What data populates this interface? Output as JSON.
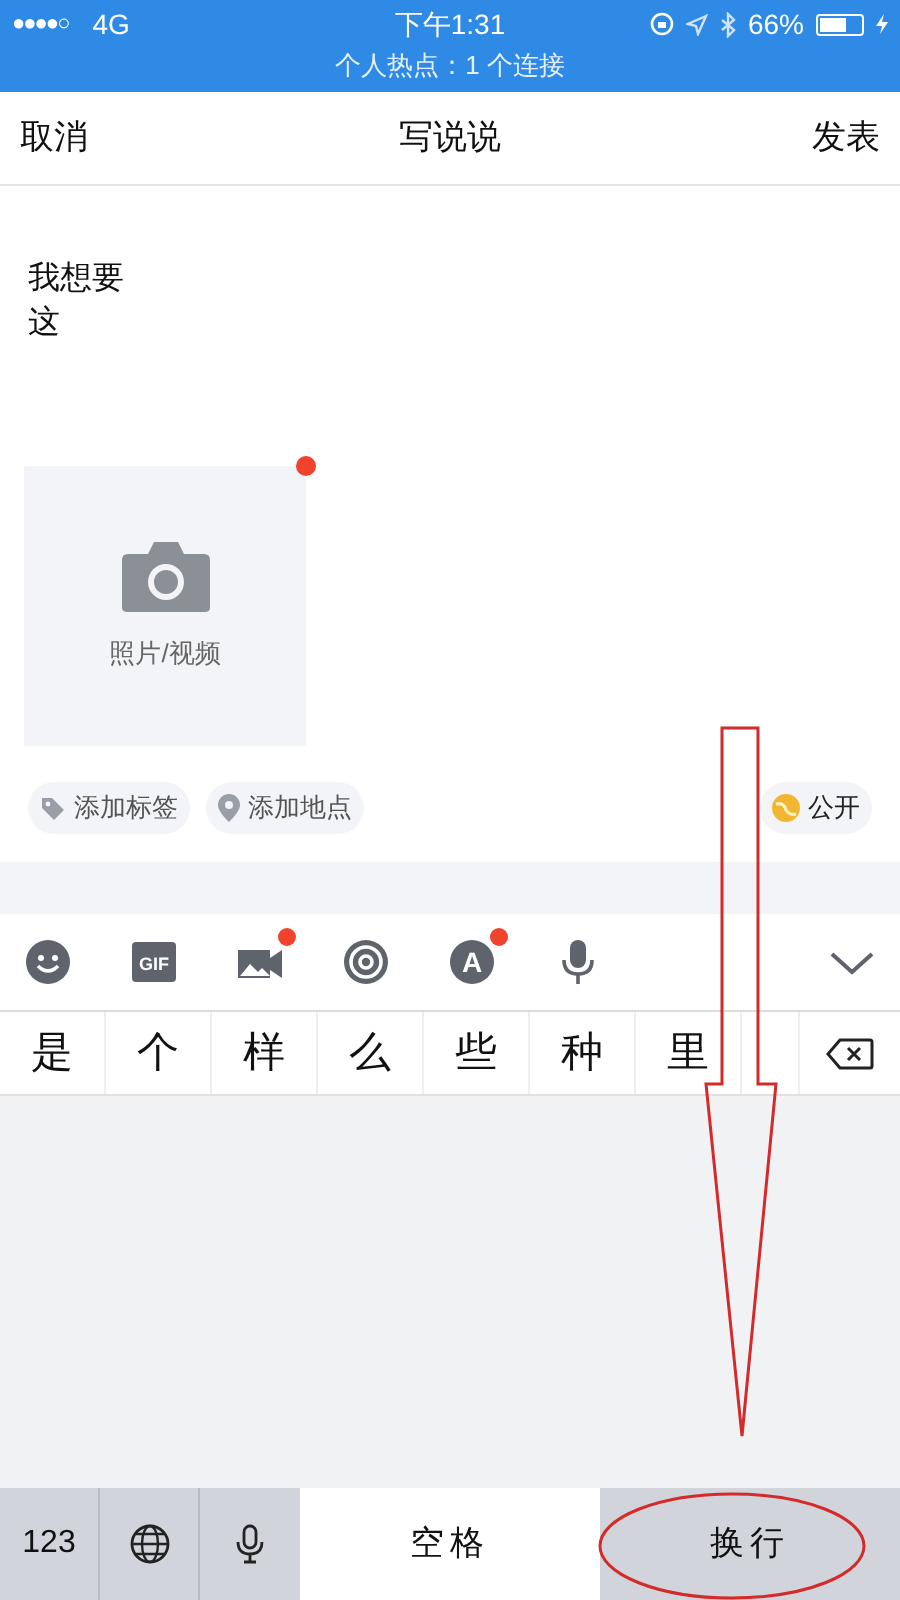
{
  "status_bar": {
    "carrier": "●●●●○",
    "network": "4G",
    "time": "下午1:31",
    "battery": "66%",
    "hotspot": "个人热点：1 个连接"
  },
  "nav": {
    "left": "取消",
    "title": "写说说",
    "right": "发表"
  },
  "editor": {
    "lines": [
      "我想要",
      "这"
    ]
  },
  "media_tile": {
    "label": "照片/视频",
    "badge": true
  },
  "chips": [
    {
      "kind": "tag",
      "label": "添加标签"
    },
    {
      "kind": "location",
      "label": "添加地点"
    }
  ],
  "visibility": {
    "label": "公开"
  },
  "toolbar": [
    {
      "kind": "emoji",
      "badge": false
    },
    {
      "kind": "gif",
      "label": "GIF",
      "badge": false
    },
    {
      "kind": "media",
      "badge": true
    },
    {
      "kind": "mention",
      "badge": false
    },
    {
      "kind": "font",
      "label": "A",
      "badge": true
    },
    {
      "kind": "voice",
      "badge": false
    },
    {
      "kind": "collapse",
      "badge": false
    }
  ],
  "candidates": [
    "是",
    "个",
    "样",
    "么",
    "些",
    "种",
    "里"
  ],
  "keyboard": {
    "numbers": "123",
    "space": "空格",
    "return": "换行"
  }
}
